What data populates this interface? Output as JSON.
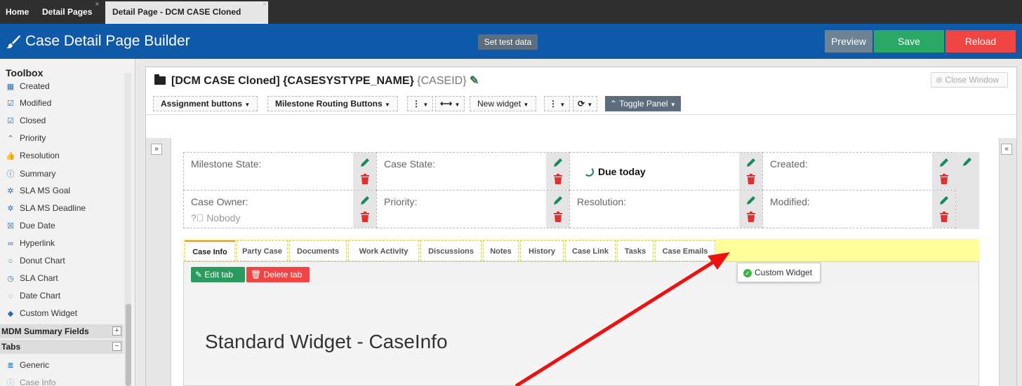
{
  "top_tabs": [
    {
      "label": "Home"
    },
    {
      "label": "Detail Pages",
      "close": "×"
    },
    {
      "label": "Detail Page - DCM CASE Cloned",
      "close": "×"
    }
  ],
  "header": {
    "title": "Case Detail Page Builder",
    "test_button": "Set test data",
    "preview_button": "Preview",
    "save_button": "Save",
    "reload_button": "Reload",
    "color": "#0f5aa8"
  },
  "toolbox": {
    "heading": "Toolbox",
    "items": [
      {
        "label": "Created",
        "icon": "calendar-grid-icon"
      },
      {
        "label": "Modified",
        "icon": "calendar-check-icon"
      },
      {
        "label": "Closed",
        "icon": "calendar-check-icon"
      },
      {
        "label": "Priority",
        "icon": "double-chevron-up-icon"
      },
      {
        "label": "Resolution",
        "icon": "thumbs-up-icon"
      },
      {
        "label": "Summary",
        "icon": "info-circle-icon"
      },
      {
        "label": "SLA MS Goal",
        "icon": "cogs-icon"
      },
      {
        "label": "SLA MS Deadline",
        "icon": "cogs-icon"
      },
      {
        "label": "Due Date",
        "icon": "calendar-x-icon"
      },
      {
        "label": "Hyperlink",
        "icon": "link-icon"
      },
      {
        "label": "Donut Chart",
        "icon": "circle-icon"
      },
      {
        "label": "SLA Chart",
        "icon": "clock-icon"
      },
      {
        "label": "Date Chart",
        "icon": "circle-notch-icon"
      },
      {
        "label": "Custom Widget",
        "icon": "tag-icon"
      }
    ],
    "groups": [
      {
        "label": "MDM Summary Fields",
        "toggle": "+"
      },
      {
        "label": "Tabs",
        "toggle": "−"
      }
    ],
    "tab_items": [
      {
        "label": "Generic",
        "icon": "database-icon"
      },
      {
        "label": "Case Info",
        "icon": "info-circle-icon"
      }
    ]
  },
  "case": {
    "name": "[DCM CASE Cloned] {CASESYSTYPE_NAME}",
    "id": "{CASEID}",
    "close_window": "Close Window"
  },
  "toolbar": {
    "assignment": "Assignment buttons",
    "milestone": "Milestone Routing Buttons",
    "new_widget": "New widget",
    "toggle_panel": "Toggle Panel"
  },
  "fields": {
    "milestone_state": "Milestone State:",
    "case_state": "Case State:",
    "due_today": "Due today",
    "created": "Created:",
    "case_owner": "Case Owner:",
    "owner_value": "Nobody",
    "priority": "Priority:",
    "resolution": "Resolution:",
    "modified": "Modified:"
  },
  "case_tabs": [
    {
      "label": "Case Info"
    },
    {
      "label": "Party Case"
    },
    {
      "label": "Documents"
    },
    {
      "label": "Work Activity"
    },
    {
      "label": "Discussions"
    },
    {
      "label": "Notes"
    },
    {
      "label": "History"
    },
    {
      "label": "Case Link"
    },
    {
      "label": "Tasks"
    },
    {
      "label": "Case Emails"
    }
  ],
  "tab_actions": {
    "edit": "Edit tab",
    "delete": "Delete tab"
  },
  "widget_title": "Standard Widget - CaseInfo",
  "drag_ghost": "Custom Widget"
}
